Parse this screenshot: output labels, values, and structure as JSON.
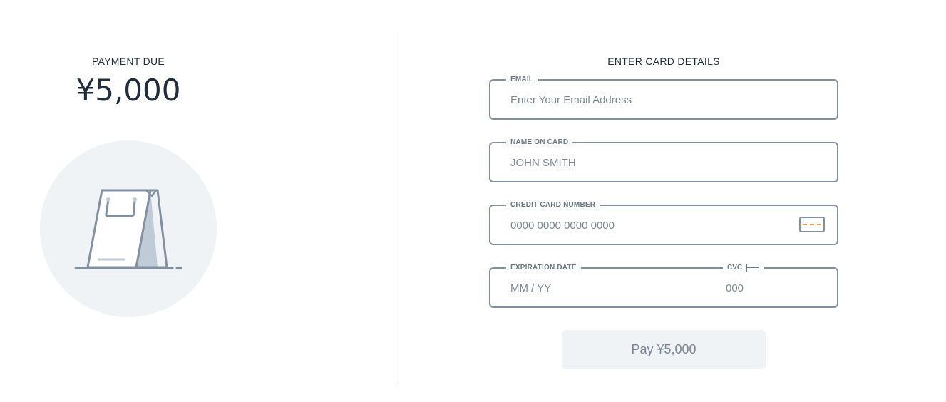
{
  "summary": {
    "label": "PAYMENT DUE",
    "amount": "¥5,000",
    "illustration": "shopping-bag-icon"
  },
  "form": {
    "title": "ENTER CARD DETAILS",
    "email": {
      "label": "EMAIL",
      "placeholder": "Enter Your Email Address"
    },
    "name": {
      "label": "NAME ON CARD",
      "placeholder": "JOHN SMITH"
    },
    "card_number": {
      "label": "CREDIT CARD NUMBER",
      "placeholder": "0000 0000 0000 0000",
      "icon": "credit-card-icon"
    },
    "expiration": {
      "label": "EXPIRATION DATE",
      "placeholder": "MM / YY"
    },
    "cvc": {
      "label": "CVC",
      "placeholder": "000",
      "icon": "card-back-icon"
    },
    "pay_button": "Pay ¥5,000"
  },
  "colors": {
    "border": "#8390a0",
    "text_dark": "#1f2d3d",
    "muted": "#7a8796",
    "accent_dash": "#f0a050",
    "circle_bg": "#eff3f6"
  }
}
